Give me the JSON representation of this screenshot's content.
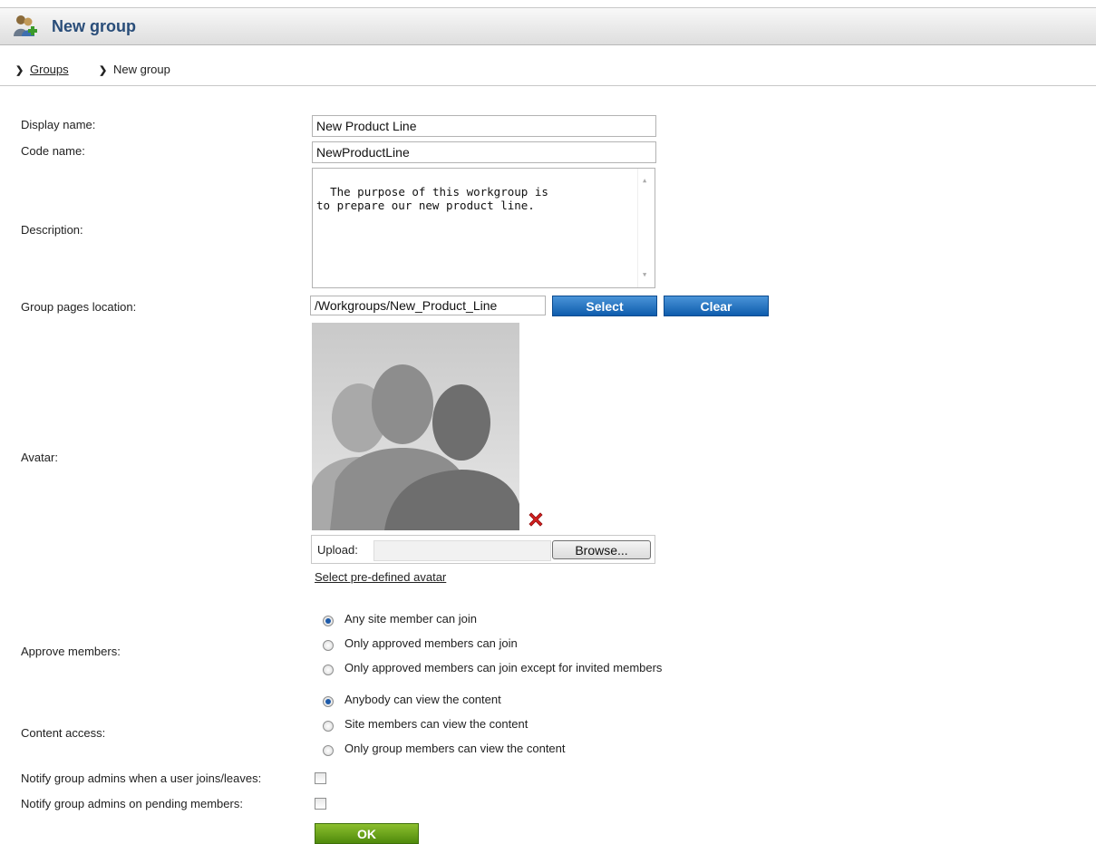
{
  "header": {
    "title": "New group",
    "icon": "group-add-icon"
  },
  "breadcrumb": {
    "parent": "Groups",
    "current": "New group"
  },
  "form": {
    "display_name": {
      "label": "Display name:",
      "value": "New Product Line"
    },
    "code_name": {
      "label": "Code name:",
      "value": "NewProductLine"
    },
    "description": {
      "label": "Description:",
      "value": "The purpose of this workgroup is\nto prepare our new product line."
    },
    "pages_location": {
      "label": "Group pages location:",
      "value": "/Workgroups/New_Product_Line",
      "select_label": "Select",
      "clear_label": "Clear"
    },
    "avatar": {
      "label": "Avatar:",
      "upload_label": "Upload:",
      "browse_label": "Browse...",
      "predefined_link": "Select pre-defined avatar"
    },
    "approve_members": {
      "label": "Approve members:",
      "options": [
        "Any site member can join",
        "Only approved members can join",
        "Only approved members can join except for invited members"
      ],
      "selected": "Any site member can join"
    },
    "content_access": {
      "label": "Content access:",
      "options": [
        "Anybody can view the content",
        "Site members can view the content",
        "Only group members can view the content"
      ],
      "selected": "Anybody can view the content"
    },
    "notify_join": {
      "label": "Notify group admins when a user joins/leaves:",
      "checked": false
    },
    "notify_pending": {
      "label": "Notify group admins on pending members:",
      "checked": false
    },
    "ok_label": "OK"
  },
  "colors": {
    "title": "#294d79",
    "blue_button": "#1565b9",
    "ok_button": "#66a01c"
  }
}
